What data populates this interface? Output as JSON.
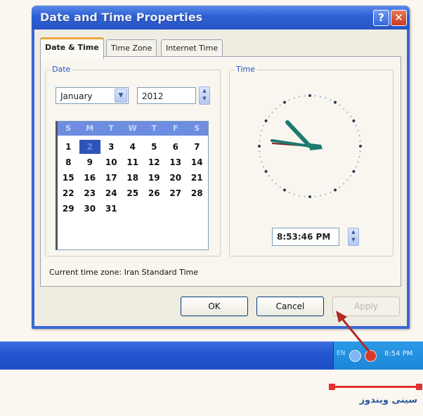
{
  "window": {
    "title": "Date and Time Properties",
    "help_glyph": "?",
    "close_glyph": "✕"
  },
  "tabs": [
    {
      "label": "Date & Time",
      "active": true
    },
    {
      "label": "Time Zone",
      "active": false
    },
    {
      "label": "Internet Time",
      "active": false
    }
  ],
  "date_group": {
    "label": "Date",
    "month_value": "January",
    "year_value": "2012",
    "weekday_headers": [
      "S",
      "M",
      "T",
      "W",
      "T",
      "F",
      "S"
    ],
    "weeks": [
      [
        "1",
        "2",
        "3",
        "4",
        "5",
        "6",
        "7"
      ],
      [
        "8",
        "9",
        "10",
        "11",
        "12",
        "13",
        "14"
      ],
      [
        "15",
        "16",
        "17",
        "18",
        "19",
        "20",
        "21"
      ],
      [
        "22",
        "23",
        "24",
        "25",
        "26",
        "27",
        "28"
      ],
      [
        "29",
        "30",
        "31",
        "",
        "",
        "",
        ""
      ]
    ],
    "selected_day": "2"
  },
  "time_group": {
    "label": "Time",
    "time_value": "8:53:46 PM"
  },
  "timezone_text": "Current time zone:  Iran Standard Time",
  "buttons": {
    "ok": "OK",
    "cancel": "Cancel",
    "apply": "Apply"
  },
  "taskbar": {
    "language": "EN",
    "clock": "8:54 PM"
  },
  "caption": "سینی ویندوز",
  "colors": {
    "title_blue": "#2d5fd4",
    "taskbar_blue": "#2656d0",
    "tray_blue": "#1c86d8",
    "annotation_red": "#e03030",
    "caption_blue": "#2c5aa0"
  }
}
